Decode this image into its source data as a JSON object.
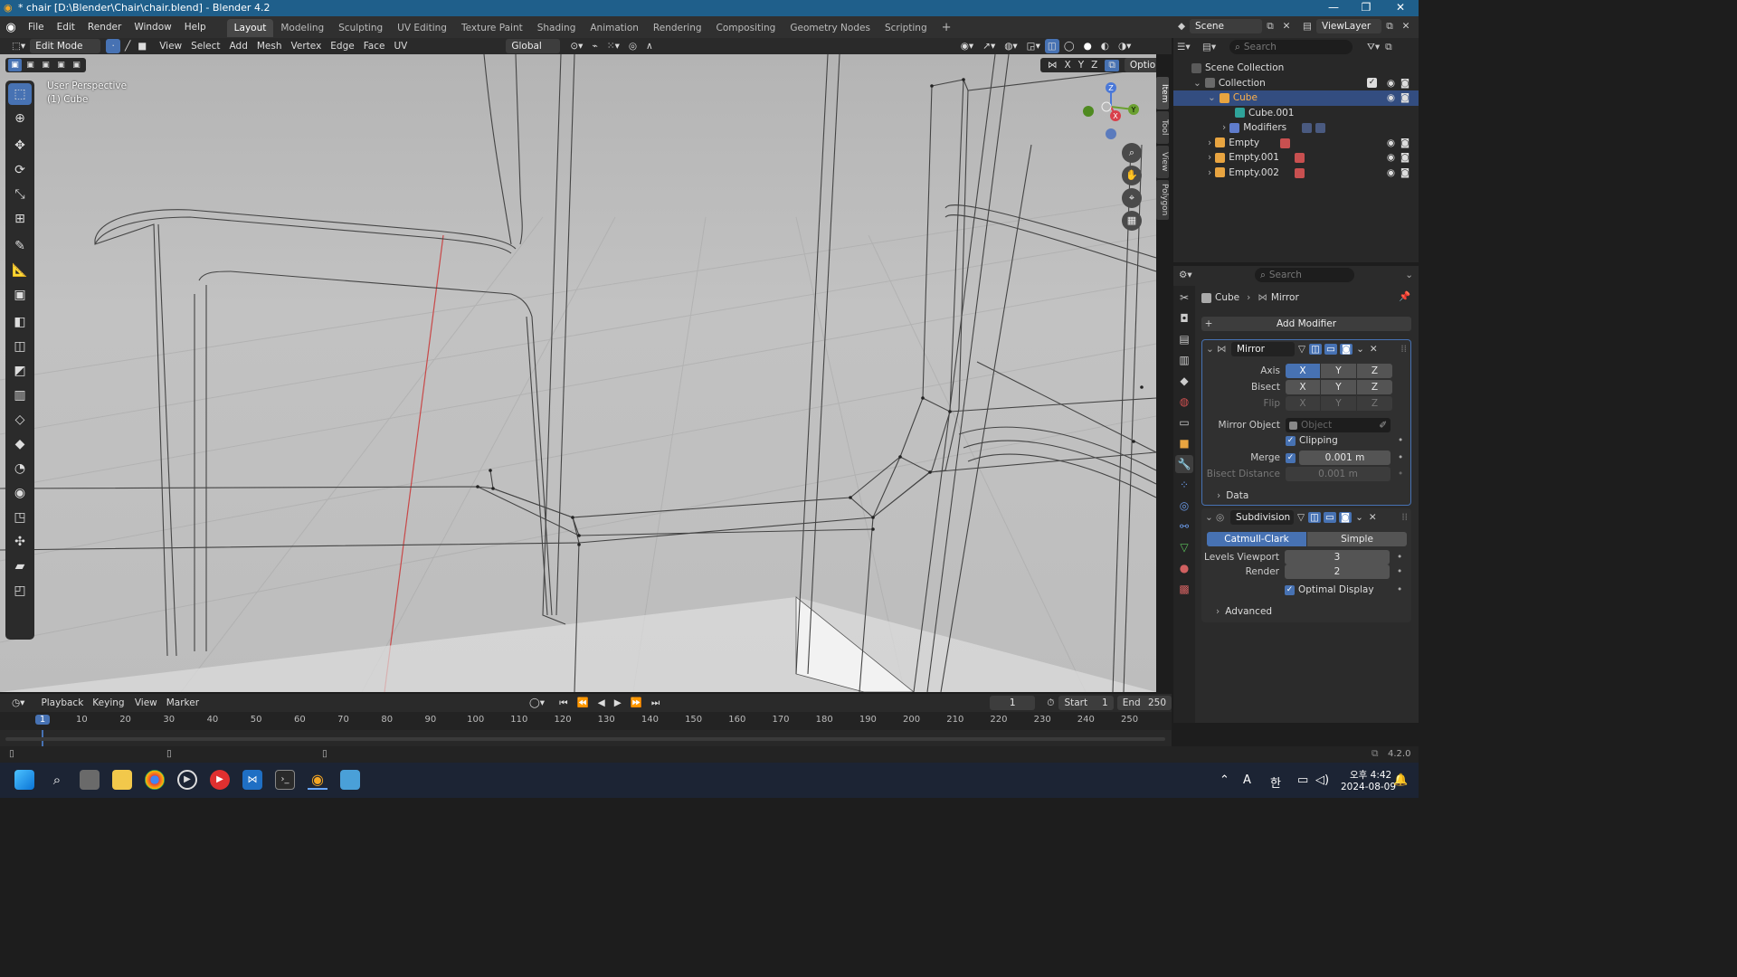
{
  "window": {
    "title": "* chair [D:\\Blender\\Chair\\chair.blend] - Blender 4.2"
  },
  "menu": [
    "File",
    "Edit",
    "Render",
    "Window",
    "Help"
  ],
  "workspaces": [
    "Layout",
    "Modeling",
    "Sculpting",
    "UV Editing",
    "Texture Paint",
    "Shading",
    "Animation",
    "Rendering",
    "Compositing",
    "Geometry Nodes",
    "Scripting"
  ],
  "active_workspace": "Layout",
  "scene": {
    "name": "Scene",
    "view_layer": "ViewLayer"
  },
  "viewport_header": {
    "mode": "Edit Mode",
    "menus": [
      "View",
      "Select",
      "Add",
      "Mesh",
      "Vertex",
      "Edge",
      "Face",
      "UV"
    ],
    "orientation": "Global",
    "options": "Options",
    "axes": [
      "X",
      "Y",
      "Z"
    ]
  },
  "viewport": {
    "perspective": "User Perspective",
    "object": "(1) Cube",
    "side_tabs": [
      "Item",
      "Tool",
      "View",
      "Polygon"
    ],
    "gizmo": {
      "z": "Z",
      "y": "Y",
      "x": "X"
    }
  },
  "outliner": {
    "search_placeholder": "Search",
    "items": [
      {
        "label": "Scene Collection"
      },
      {
        "label": "Collection"
      },
      {
        "label": "Cube"
      },
      {
        "label": "Cube.001"
      },
      {
        "label": "Modifiers"
      },
      {
        "label": "Empty"
      },
      {
        "label": "Empty.001"
      },
      {
        "label": "Empty.002"
      }
    ]
  },
  "properties": {
    "search_placeholder": "Search",
    "breadcrumb": {
      "object": "Cube",
      "modifier": "Mirror"
    },
    "add_modifier": "Add Modifier",
    "mirror": {
      "name": "Mirror",
      "axis_label": "Axis",
      "bisect_label": "Bisect",
      "flip_label": "Flip",
      "xyz": [
        "X",
        "Y",
        "Z"
      ],
      "mirror_object_label": "Mirror Object",
      "mirror_object_placeholder": "Object",
      "clipping_label": "Clipping",
      "merge_label": "Merge",
      "merge_value": "0.001 m",
      "bisect_distance_label": "Bisect Distance",
      "bisect_distance_value": "0.001 m",
      "data_label": "Data"
    },
    "subdivision": {
      "name": "Subdivision",
      "catmull": "Catmull-Clark",
      "simple": "Simple",
      "levels_viewport_label": "Levels Viewport",
      "levels_viewport_value": "3",
      "render_label": "Render",
      "render_value": "2",
      "optimal_label": "Optimal Display",
      "advanced_label": "Advanced"
    }
  },
  "timeline": {
    "menus": [
      "Playback",
      "Keying",
      "View",
      "Marker"
    ],
    "current_frame": "1",
    "start_label": "Start",
    "start": "1",
    "end_label": "End",
    "end": "250",
    "ruler": [
      "1",
      "10",
      "20",
      "30",
      "40",
      "50",
      "60",
      "70",
      "80",
      "90",
      "100",
      "110",
      "120",
      "130",
      "140",
      "150",
      "160",
      "170",
      "180",
      "190",
      "200",
      "210",
      "220",
      "230",
      "240",
      "250"
    ]
  },
  "status": {
    "version": "4.2.0"
  },
  "taskbar": {
    "time": "오후 4:42",
    "date": "2024-08-09",
    "ime": "A",
    "ime2": "한"
  },
  "colors": {
    "accent": "#4772b3",
    "titlebar": "#1f5f8b",
    "selected_row": "#334d80"
  }
}
